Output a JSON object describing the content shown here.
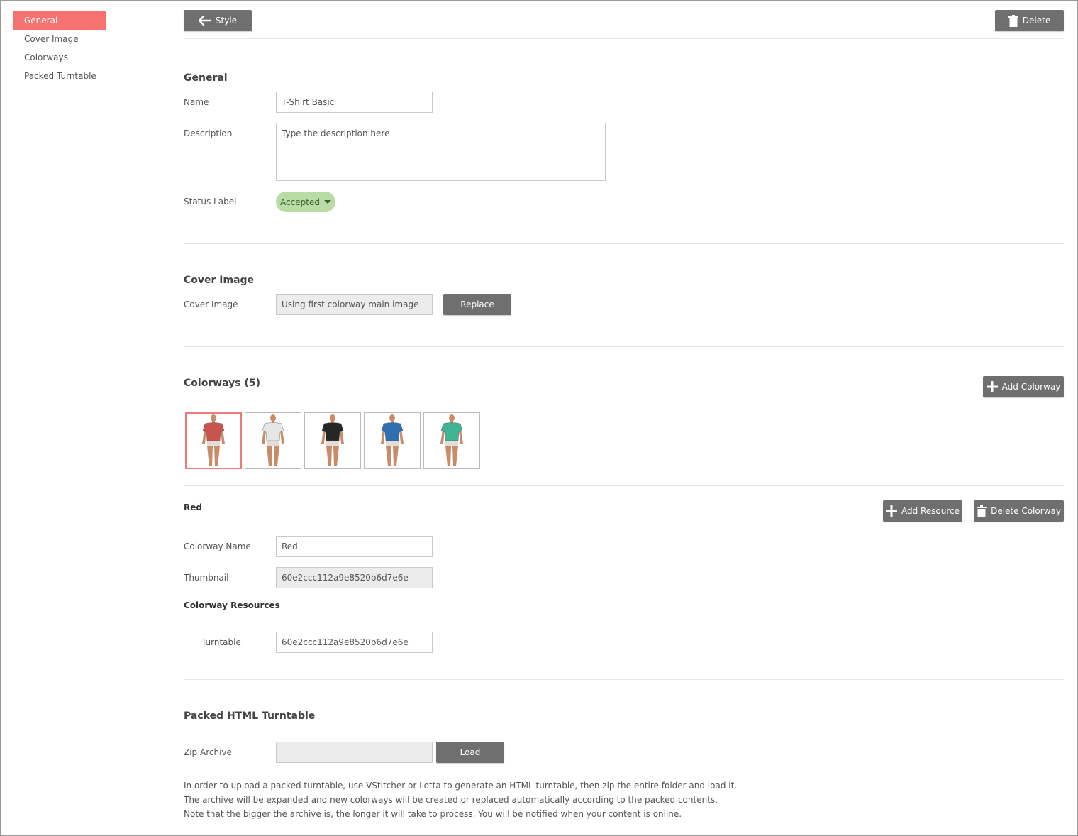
{
  "sidebar": {
    "items": [
      {
        "label": "General",
        "active": true
      },
      {
        "label": "Cover Image",
        "active": false
      },
      {
        "label": "Colorways",
        "active": false
      },
      {
        "label": "Packed Turntable",
        "active": false
      }
    ]
  },
  "toolbar": {
    "back_label": "Style",
    "delete_label": "Delete"
  },
  "general": {
    "title": "General",
    "name_label": "Name",
    "name_value": "T-Shirt Basic",
    "description_label": "Description",
    "description_placeholder": "Type the description here",
    "status_label": "Status Label",
    "status_value": "Accepted"
  },
  "cover": {
    "title": "Cover Image",
    "label": "Cover Image",
    "value": "Using first colorway main image",
    "replace_label": "Replace"
  },
  "colorways": {
    "title": "Colorways (5)",
    "add_label": "Add Colorway",
    "items": [
      {
        "shirt_color": "#c9534f",
        "selected": true
      },
      {
        "shirt_color": "#e6e6e6",
        "selected": false
      },
      {
        "shirt_color": "#262626",
        "selected": false
      },
      {
        "shirt_color": "#2f6fb0",
        "selected": false
      },
      {
        "shirt_color": "#3fb393",
        "selected": false
      }
    ]
  },
  "selected_colorway": {
    "title": "Red",
    "add_resource_label": "Add Resource",
    "delete_colorway_label": "Delete Colorway",
    "name_label": "Colorway Name",
    "name_value": "Red",
    "thumbnail_label": "Thumbnail",
    "thumbnail_value": "60e2ccc112a9e8520b6d7e6e",
    "resources_label": "Colorway Resources",
    "turntable_label": "Turntable",
    "turntable_value": "60e2ccc112a9e8520b6d7e6e"
  },
  "packed": {
    "title": "Packed HTML Turntable",
    "zip_label": "Zip Archive",
    "zip_value": "",
    "load_label": "Load",
    "info": [
      "In order to upload a packed turntable, use VStitcher or Lotta to generate an HTML turntable, then zip the entire folder and load it.",
      "The archive will be expanded and new colorways will be created or replaced automatically according to the packed contents.",
      "Note that the bigger the archive is, the longer it will take to process. You will be notified when your content is online."
    ]
  },
  "colors": {
    "accent": "#f87171",
    "button": "#6f6f6f",
    "status_pill": "#b9dba4",
    "skin": "#c98c6a"
  }
}
